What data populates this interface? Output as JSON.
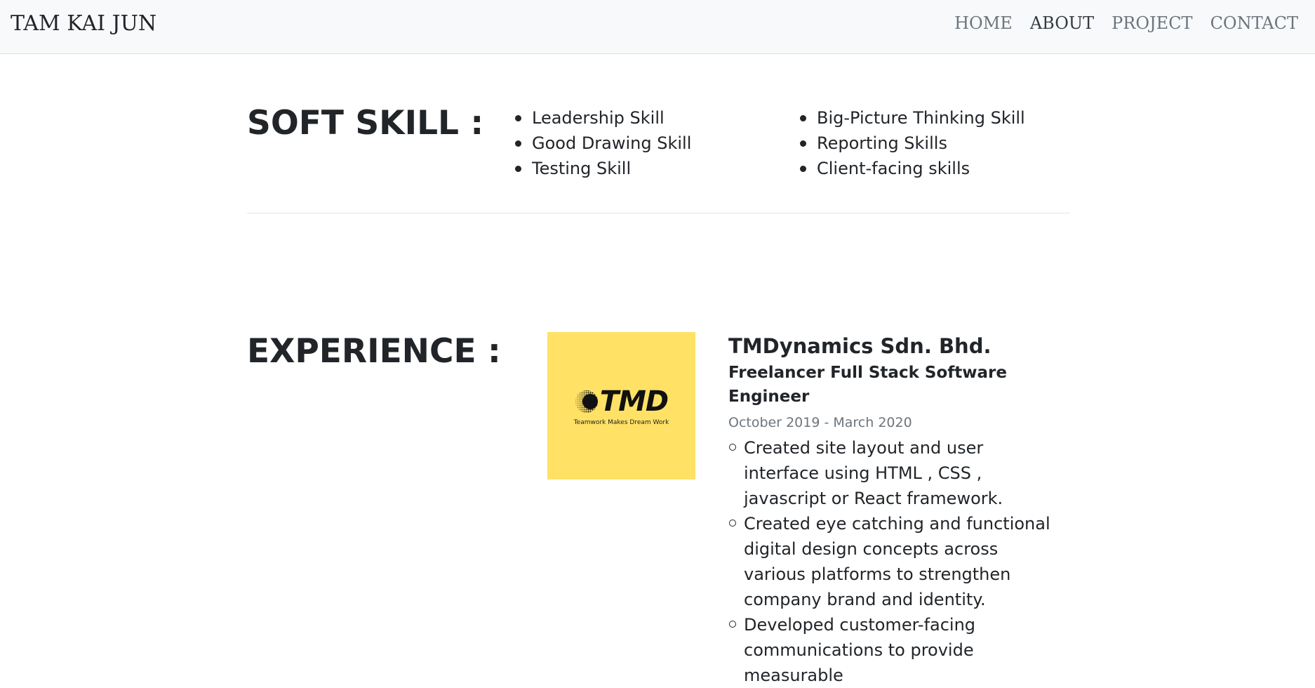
{
  "navbar": {
    "brand": "TAM KAI JUN",
    "links": [
      "HOME",
      "ABOUT",
      "PROJECT",
      "CONTACT"
    ],
    "active": "ABOUT"
  },
  "soft_skill": {
    "title": "SOFT SKILL :",
    "column1": [
      "Leadership Skill",
      "Good Drawing Skill",
      "Testing Skill"
    ],
    "column2": [
      "Big-Picture Thinking Skill",
      "Reporting Skills",
      "Client-facing skills"
    ]
  },
  "experience": {
    "title": "EXPERIENCE :",
    "logo": {
      "text": "TMD",
      "tagline": "Teamwork Makes Dream Work",
      "background": "#ffe165"
    },
    "company": "TMDynamics Sdn. Bhd.",
    "role": "Freelancer Full Stack Software Engineer",
    "dates": "October 2019 - March 2020",
    "duties": [
      "Created site layout and user interface using HTML , CSS , javascript or React framework.",
      "Created eye catching and functional digital design concepts across various platforms to strengthen company brand and identity.",
      "Developed customer-facing communications to provide measurable"
    ]
  },
  "colors": {
    "navbar_bg": "#f8f9fa",
    "nav_link": "#6c757d",
    "nav_active": "#343a40",
    "text": "#212529",
    "muted": "#6c757d"
  }
}
